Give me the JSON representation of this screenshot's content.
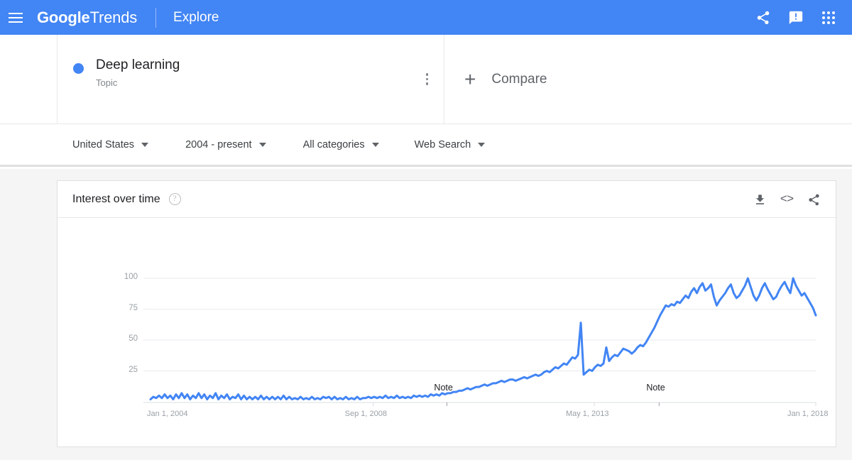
{
  "header": {
    "menu_icon": "hamburger-menu-icon",
    "brand_bold": "Google",
    "brand_light": "Trends",
    "explore_label": "Explore",
    "share_icon": "share-icon",
    "feedback_icon": "feedback-icon",
    "apps_icon": "apps-grid-icon",
    "background_color": "#4285f4"
  },
  "term": {
    "name": "Deep learning",
    "type": "Topic",
    "dot_color": "#4285f4",
    "menu_icon": "more-options-icon"
  },
  "compare": {
    "plus": "+",
    "label": "Compare"
  },
  "filters": [
    {
      "label": "United States"
    },
    {
      "label": "2004 - present"
    },
    {
      "label": "All categories"
    },
    {
      "label": "Web Search"
    }
  ],
  "card": {
    "title": "Interest over time",
    "help_icon": "help-circle-icon",
    "download_icon": "download-icon",
    "embed_icon": "embed-code-icon",
    "embed_glyph": "<>",
    "share_icon": "share-icon"
  },
  "chart_data": {
    "type": "line",
    "title": "Interest over time",
    "xlabel": "",
    "ylabel": "",
    "ylim": [
      0,
      100
    ],
    "yticks": [
      100,
      75,
      50,
      25
    ],
    "xticks": [
      "Jan 1, 2004",
      "Sep 1, 2008",
      "May 1, 2013",
      "Jan 1, 2018"
    ],
    "xtick_positions": [
      0.0,
      0.3347,
      0.667,
      1.0
    ],
    "grid": true,
    "line_color": "#4285f4",
    "line_width": 3,
    "annotations": [
      {
        "label": "Note",
        "x_frac": 0.4455
      },
      {
        "label": "Note",
        "x_frac": 0.7645
      }
    ],
    "series": [
      {
        "name": "Deep learning",
        "color": "#4285f4",
        "values": [
          2,
          4,
          3,
          5,
          3,
          6,
          3,
          5,
          2,
          6,
          3,
          7,
          3,
          6,
          2,
          5,
          3,
          7,
          3,
          6,
          2,
          5,
          3,
          7,
          2,
          5,
          3,
          6,
          2,
          4,
          3,
          6,
          2,
          5,
          2,
          4,
          2,
          4,
          2,
          5,
          2,
          4,
          2,
          4,
          2,
          4,
          2,
          5,
          2,
          4,
          2,
          3,
          2,
          4,
          2,
          3,
          2,
          4,
          2,
          3,
          2,
          4,
          3,
          4,
          2,
          4,
          2,
          3,
          2,
          4,
          2,
          3,
          2,
          4,
          2,
          3,
          3,
          4,
          3,
          4,
          3,
          4,
          3,
          5,
          3,
          4,
          3,
          5,
          3,
          4,
          3,
          4,
          3,
          5,
          4,
          5,
          4,
          5,
          4,
          6,
          5,
          6,
          5,
          7,
          6,
          7,
          7,
          8,
          8,
          9,
          9,
          10,
          11,
          10,
          11,
          12,
          12,
          13,
          14,
          13,
          14,
          15,
          15,
          16,
          17,
          16,
          17,
          18,
          18,
          17,
          18,
          19,
          20,
          19,
          20,
          21,
          22,
          21,
          22,
          24,
          25,
          24,
          26,
          28,
          27,
          29,
          31,
          30,
          33,
          36,
          35,
          38,
          64,
          22,
          24,
          26,
          25,
          28,
          30,
          29,
          31,
          44,
          33,
          36,
          38,
          37,
          40,
          43,
          42,
          41,
          39,
          41,
          44,
          46,
          45,
          48,
          52,
          56,
          60,
          65,
          70,
          74,
          78,
          77,
          79,
          78,
          81,
          80,
          83,
          86,
          84,
          89,
          92,
          88,
          93,
          96,
          90,
          92,
          95,
          85,
          78,
          82,
          85,
          88,
          92,
          95,
          88,
          84,
          86,
          90,
          94,
          100,
          93,
          86,
          82,
          86,
          92,
          96,
          91,
          87,
          83,
          85,
          90,
          94,
          97,
          92,
          88,
          100,
          94,
          90,
          86,
          88,
          84,
          80,
          76,
          70
        ]
      }
    ]
  }
}
